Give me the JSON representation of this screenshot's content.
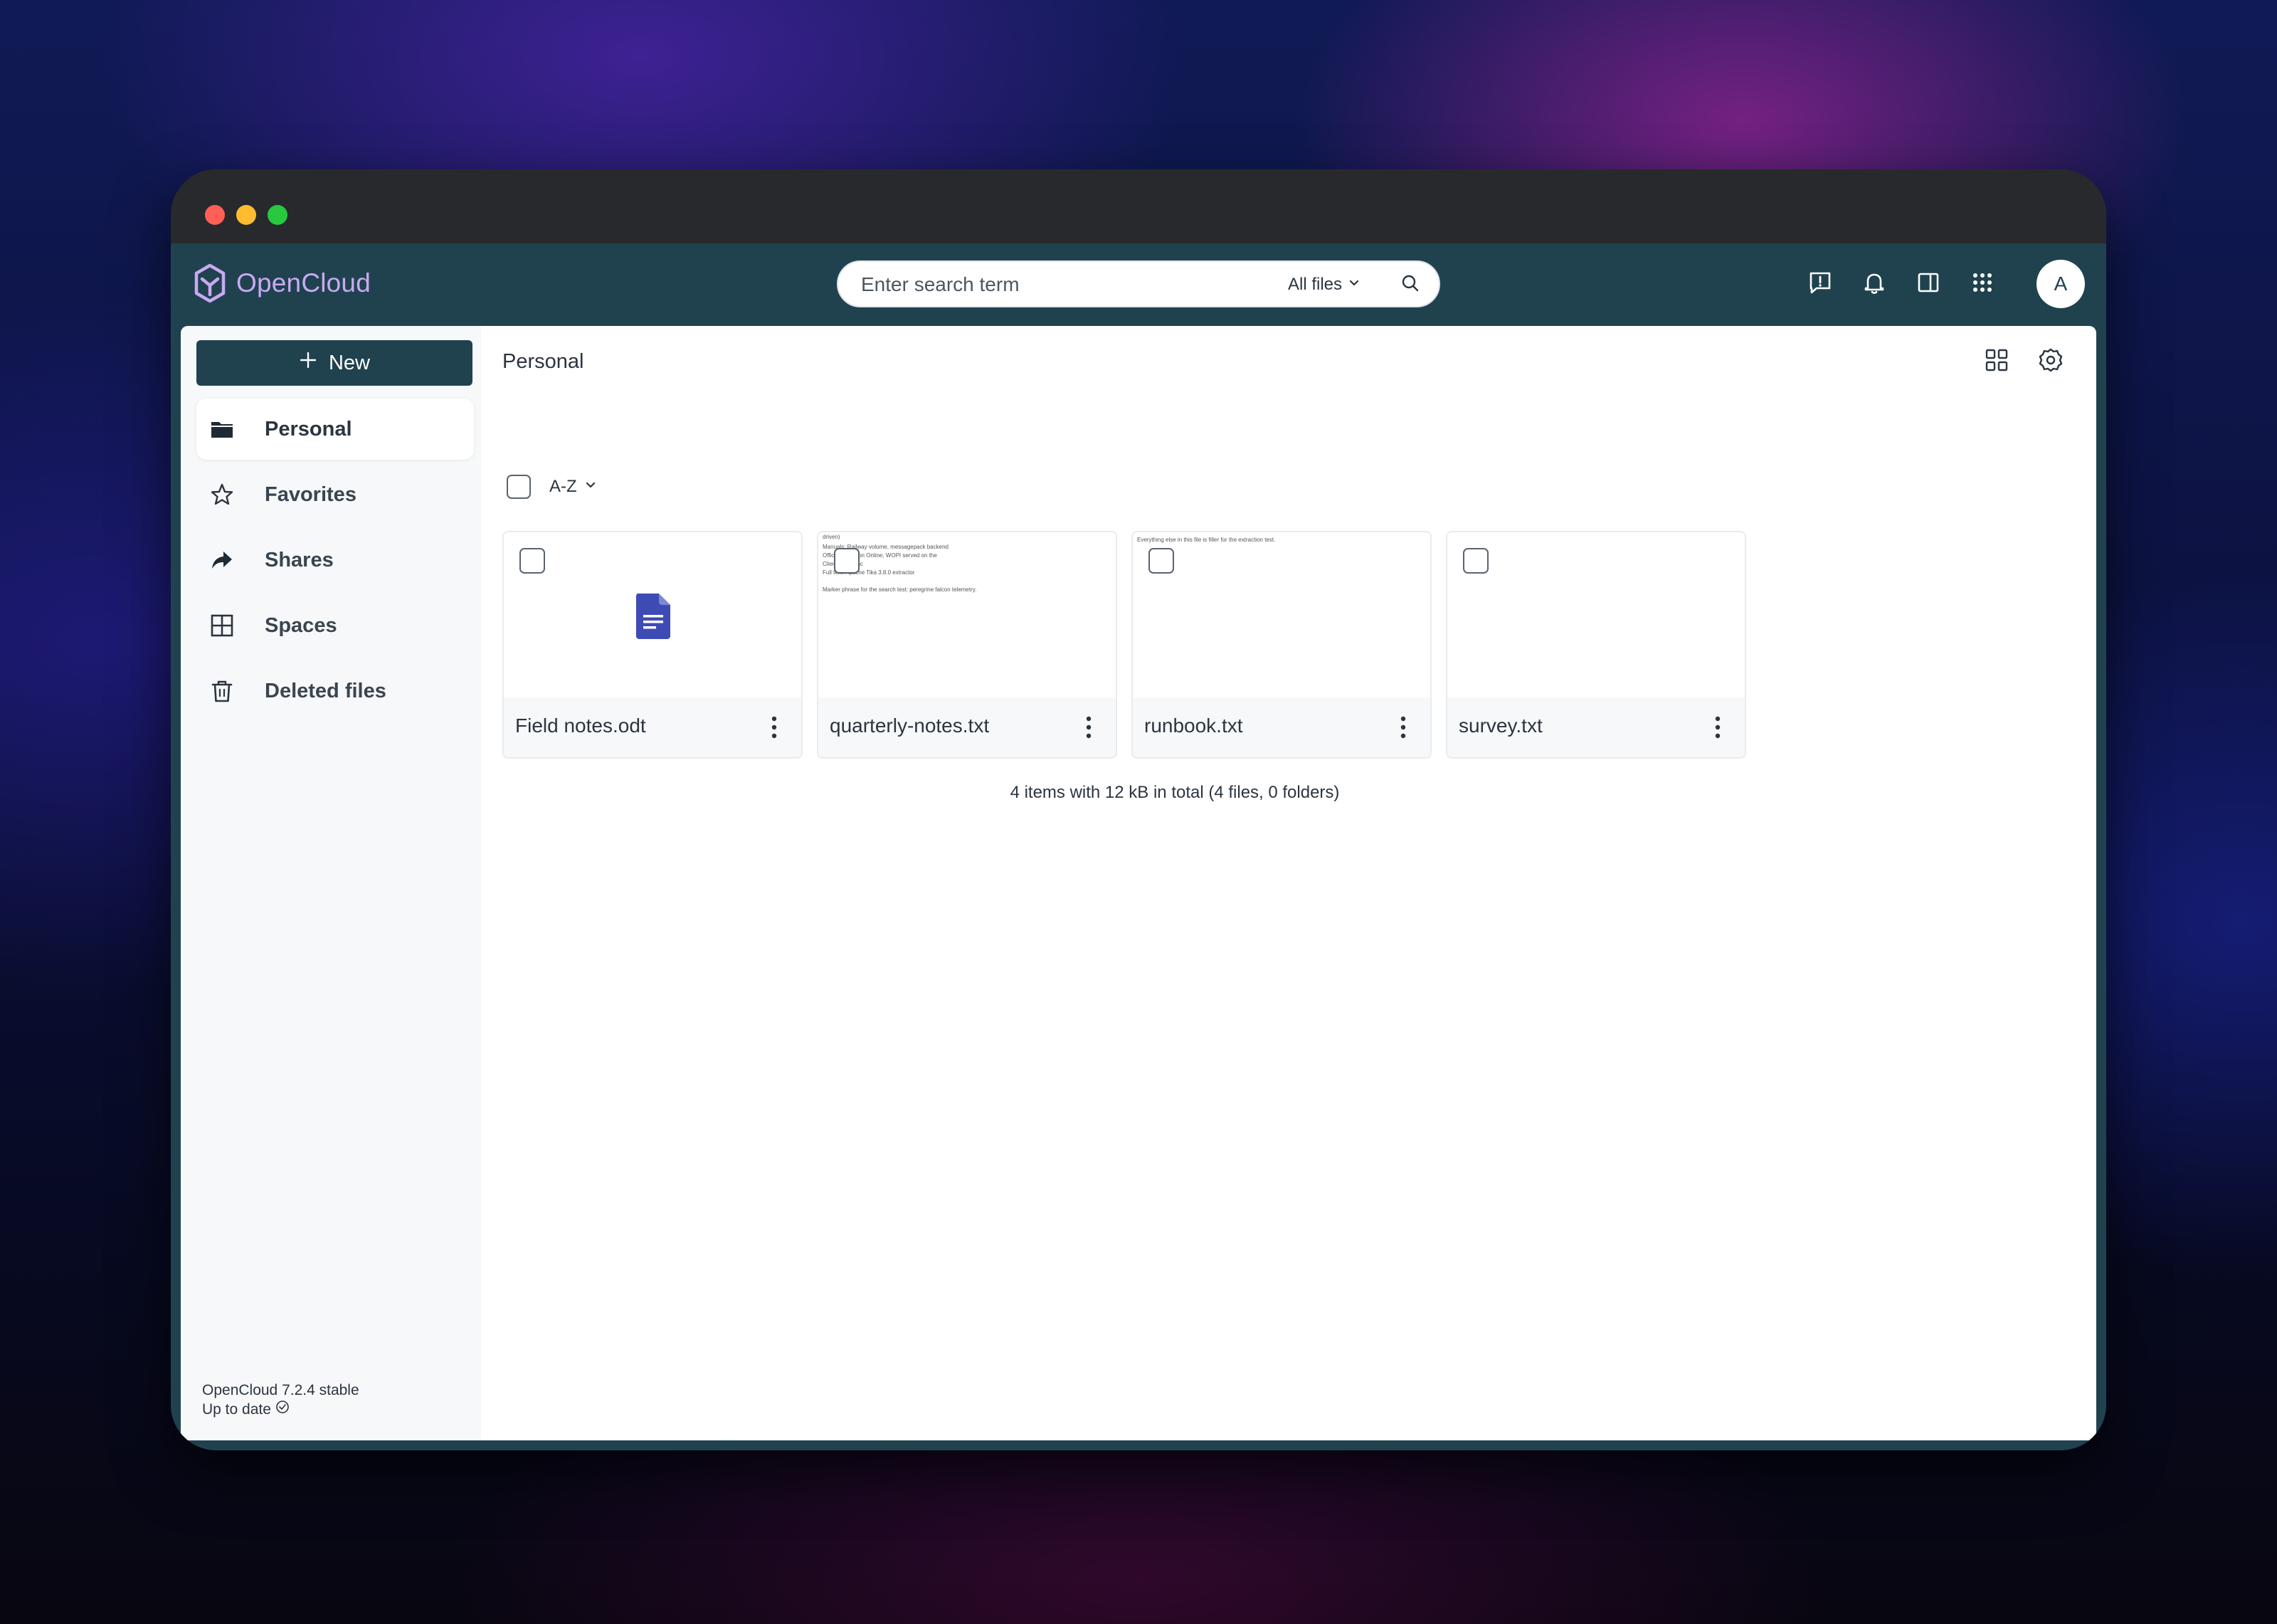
{
  "app": {
    "name": "OpenCloud",
    "colors": {
      "header": "#20424f",
      "brand": "#c9a9f2",
      "file_icon": "#3f4bb5"
    }
  },
  "search": {
    "placeholder": "Enter search term",
    "scope": "All files"
  },
  "header_icons": [
    "feedback-icon",
    "bell-icon",
    "sidebar-panel-icon",
    "apps-grid-icon"
  ],
  "user": {
    "initial": "A"
  },
  "sidebar": {
    "new_label": "New",
    "items": [
      {
        "label": "Personal",
        "icon": "folder-icon",
        "active": true
      },
      {
        "label": "Favorites",
        "icon": "star-icon",
        "active": false
      },
      {
        "label": "Shares",
        "icon": "share-icon",
        "active": false
      },
      {
        "label": "Spaces",
        "icon": "spaces-grid-icon",
        "active": false
      },
      {
        "label": "Deleted files",
        "icon": "trash-icon",
        "active": false
      }
    ],
    "version": "OpenCloud 7.2.4 stable",
    "status": "Up to date"
  },
  "main": {
    "breadcrumb": "Personal",
    "sort_label": "A-Z",
    "files": [
      {
        "name": "Field notes.odt",
        "preview": "icon",
        "preview_lines": []
      },
      {
        "name": "quarterly-notes.txt",
        "preview": "text",
        "preview_lines": [
          "driven)",
          "Manuals: Railway volume, messagepack backend",
          "Office: validation Online, WOPI served on the",
          "Client: iOS sync",
          "Full text: Apache Tika 3.8.0 extractor",
          "",
          "Marker phrase for the search test: peregrine falcon telemetry."
        ]
      },
      {
        "name": "runbook.txt",
        "preview": "text",
        "preview_lines": [
          "Everything else in this file is filler for the extraction test."
        ]
      },
      {
        "name": "survey.txt",
        "preview": "text",
        "preview_lines": []
      }
    ],
    "summary": "4 items with 12 kB in total (4 files, 0 folders)"
  }
}
